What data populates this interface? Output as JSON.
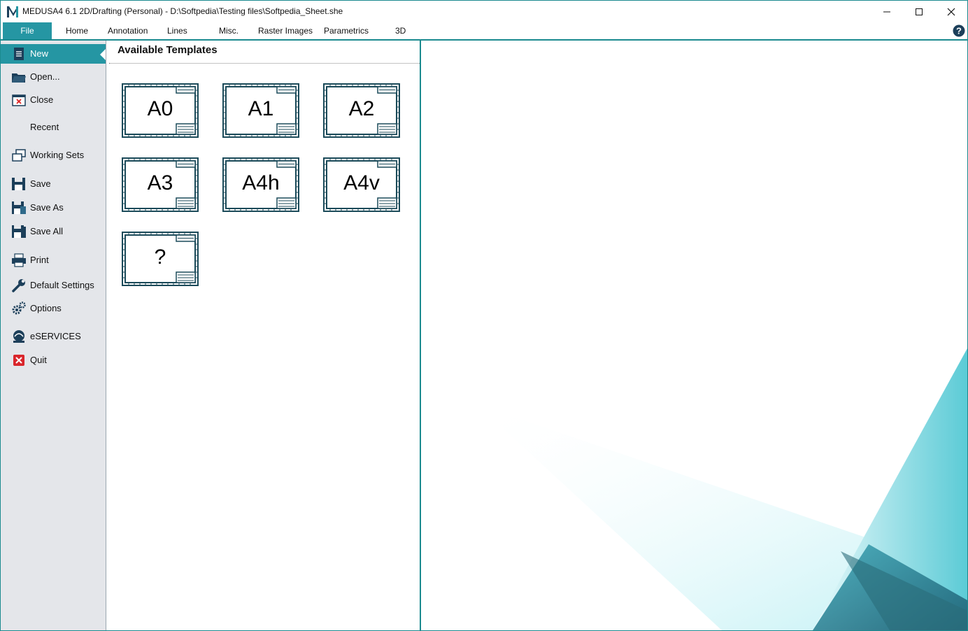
{
  "window": {
    "title": "MEDUSA4 6.1 2D/Drafting (Personal) - D:\\Softpedia\\Testing files\\Softpedia_Sheet.she"
  },
  "tabs": [
    {
      "label": "File"
    },
    {
      "label": "Home"
    },
    {
      "label": "Annotation"
    },
    {
      "label": "Lines"
    },
    {
      "label": "Misc."
    },
    {
      "label": "Raster Images"
    },
    {
      "label": "Parametrics"
    },
    {
      "label": "3D"
    }
  ],
  "menu": [
    {
      "label": "New",
      "icon": "new-document-icon"
    },
    {
      "label": "Open...",
      "icon": "open-folder-icon"
    },
    {
      "label": "Close",
      "icon": "close-document-icon"
    },
    {
      "label": "Recent",
      "icon": ""
    },
    {
      "label": "Working Sets",
      "icon": "working-sets-icon"
    },
    {
      "label": "Save",
      "icon": "save-icon"
    },
    {
      "label": "Save As",
      "icon": "save-as-icon"
    },
    {
      "label": "Save All",
      "icon": "save-all-icon"
    },
    {
      "label": "Print",
      "icon": "printer-icon"
    },
    {
      "label": "Default Settings",
      "icon": "wrench-icon"
    },
    {
      "label": "Options",
      "icon": "gears-icon"
    },
    {
      "label": "eSERVICES",
      "icon": "eservices-icon"
    },
    {
      "label": "Quit",
      "icon": "quit-icon"
    }
  ],
  "templates": {
    "title": "Available Templates",
    "items": [
      {
        "label": "A0"
      },
      {
        "label": "A1"
      },
      {
        "label": "A2"
      },
      {
        "label": "A3"
      },
      {
        "label": "A4h"
      },
      {
        "label": "A4v"
      },
      {
        "label": "?"
      }
    ]
  },
  "colors": {
    "accent": "#2596a3",
    "frame": "#1c4b5a",
    "menu_bg": "#e4e6ea",
    "decor_dark": "#2a6d7a",
    "decor_light": "#8fdde6"
  }
}
